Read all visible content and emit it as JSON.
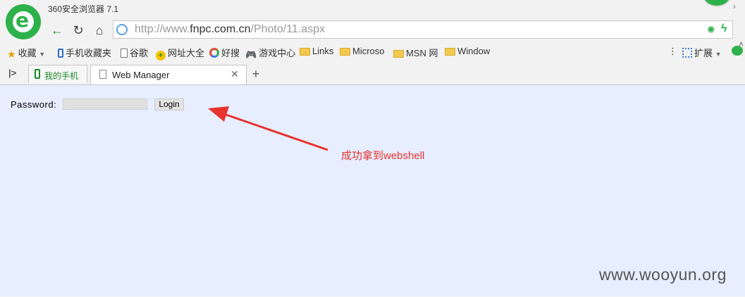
{
  "browser": {
    "title": "360安全浏览器 7.1",
    "url_host_prefix": "http://www.",
    "url_host": "fnpc.com.cn",
    "url_path": "/Photo/11.aspx"
  },
  "bookmarks": {
    "favorites": "收藏",
    "mobile_favorites": "手机收藏夹",
    "google": "谷歌",
    "site_nav": "网址大全",
    "haosou": "好搜",
    "game_center": "游戏中心",
    "links": "Links",
    "microso": "Microso",
    "msn": "MSN 网",
    "window": "Window",
    "extensions": "扩展"
  },
  "tabs": {
    "mobile_tab": "我的手机",
    "active_tab": "Web Manager"
  },
  "page": {
    "password_label": "Password:",
    "login_button": "Login",
    "annotation": "成功拿到webshell",
    "watermark": "www.wooyun.org"
  },
  "colors": {
    "brand_green": "#2db14a",
    "page_background": "#e6eeff",
    "annotation_red": "#e8332e"
  }
}
